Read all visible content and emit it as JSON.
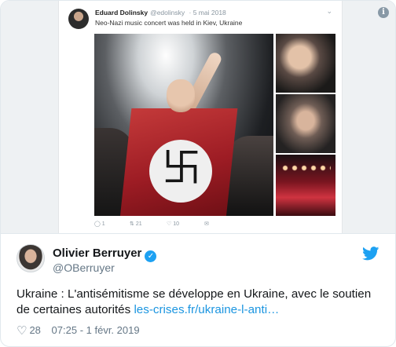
{
  "embedded_tweet": {
    "name": "Eduard Dolinsky",
    "handle": "@edolinsky",
    "date": "· 5 mai 2018",
    "text": "Neo-Nazi music concert was held in Kiev, Ukraine",
    "actions": {
      "reply": "1",
      "retweet": "21",
      "like": "10"
    },
    "flag_symbol": "卐"
  },
  "info_icon_label": "i",
  "author": {
    "name": "Olivier Berruyer",
    "handle": "@OBerruyer",
    "verified_mark": "✓"
  },
  "tweet": {
    "text": "Ukraine : L'antisémitisme se développe en Ukraine, avec le soutien de certaines autorités ",
    "link": "les-crises.fr/ukraine-l-anti…"
  },
  "footer": {
    "likes": "28",
    "timestamp": "07:25 - 1 févr. 2019"
  },
  "icons": [
    "info-icon",
    "twitter-bird-icon",
    "verified-icon",
    "heart-icon",
    "reply-icon",
    "retweet-icon",
    "like-icon",
    "share-icon"
  ],
  "colors": {
    "brand_blue": "#1da1f2",
    "link": "#1b95e0",
    "muted": "#657786"
  }
}
